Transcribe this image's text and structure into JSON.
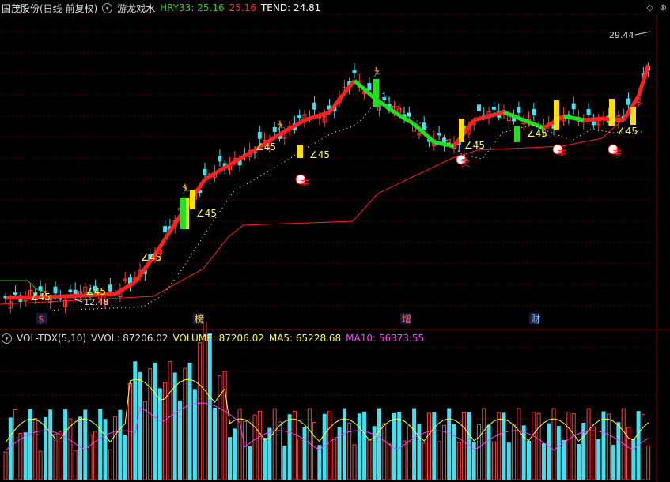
{
  "header": {
    "stock_name": "国茂股份(日线 前复权)",
    "indicator_name": "游龙戏水",
    "hry_label": "HRY33: 25.16",
    "hry_value2": "25.16",
    "tend_label": "TEND: 24.81",
    "colors": {
      "hry": "#28c828",
      "hry2": "#ff3030",
      "tend": "#ffffff",
      "name": "#dddddd"
    }
  },
  "window_controls": {
    "diamond": "◇",
    "pin": "⊗"
  },
  "price_labels": {
    "high": "29.44",
    "low": "12.48",
    "angle": "∠45"
  },
  "event_markers": [
    {
      "label": "$",
      "color": "#ff4040"
    },
    {
      "label": "榜",
      "color": "#ffd040"
    },
    {
      "label": "增",
      "color": "#ff6060"
    },
    {
      "label": "财",
      "color": "#80c0ff"
    }
  ],
  "sell_mark": "卖",
  "volume_header": {
    "indicator": "VOL-TDX(5,10)",
    "vvol": "VVOL: 87206.02",
    "volume": "VOLUME: 87206.02",
    "ma5": "MA5: 65228.68",
    "ma10": "MA10: 56373.55",
    "colors": {
      "indicator": "#dddddd",
      "vvol": "#dddddd",
      "volume": "#ffff40",
      "ma5": "#ffff40",
      "ma10": "#ff40ff"
    }
  },
  "chart_data": {
    "type": "candlestick",
    "price_range": [
      11.5,
      30.5
    ],
    "volume_range": [
      0,
      130000
    ],
    "series": [
      {
        "name": "HRY33",
        "color": "#28c828"
      },
      {
        "name": "TEND",
        "color": "#ffffff"
      }
    ]
  }
}
